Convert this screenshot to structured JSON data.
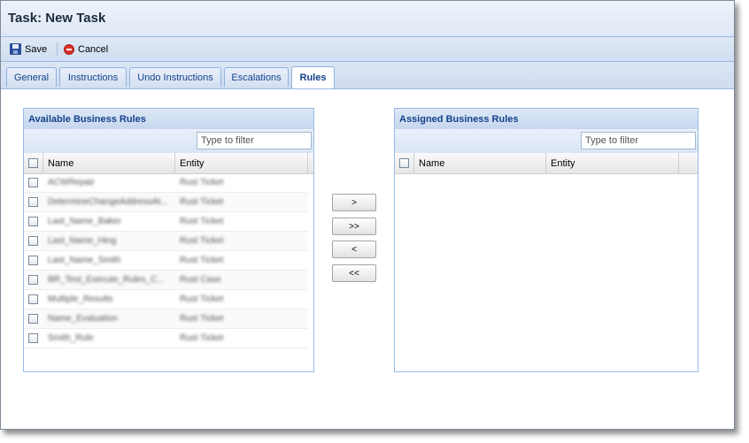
{
  "title": "Task: New Task",
  "toolbar": {
    "save_label": "Save",
    "cancel_label": "Cancel"
  },
  "tabs": [
    {
      "label": "General"
    },
    {
      "label": "Instructions"
    },
    {
      "label": "Undo Instructions"
    },
    {
      "label": "Escalations"
    },
    {
      "label": "Rules",
      "active": true
    }
  ],
  "available": {
    "title": "Available Business Rules",
    "filter_placeholder": "Type to filter",
    "columns": {
      "name": "Name",
      "entity": "Entity"
    },
    "rows": [
      {
        "name": "ACWRepair",
        "entity": "Rust Ticket"
      },
      {
        "name": "DetermineChangeAddressAt...",
        "entity": "Rust Ticket"
      },
      {
        "name": "Last_Name_Baker",
        "entity": "Rust Ticket"
      },
      {
        "name": "Last_Name_Hing",
        "entity": "Rust Ticket"
      },
      {
        "name": "Last_Name_Smith",
        "entity": "Rust Ticket"
      },
      {
        "name": "BR_Test_Execute_Rules_C...",
        "entity": "Rust Case"
      },
      {
        "name": "Multiple_Results",
        "entity": "Rust Ticket"
      },
      {
        "name": "Name_Evaluation",
        "entity": "Rust Ticket"
      },
      {
        "name": "Smith_Rule",
        "entity": "Rust Ticket"
      }
    ]
  },
  "assigned": {
    "title": "Assigned Business Rules",
    "filter_placeholder": "Type to filter",
    "columns": {
      "name": "Name",
      "entity": "Entity"
    }
  },
  "move_buttons": {
    "add_one": ">",
    "add_all": ">>",
    "remove_one": "<",
    "remove_all": "<<"
  }
}
